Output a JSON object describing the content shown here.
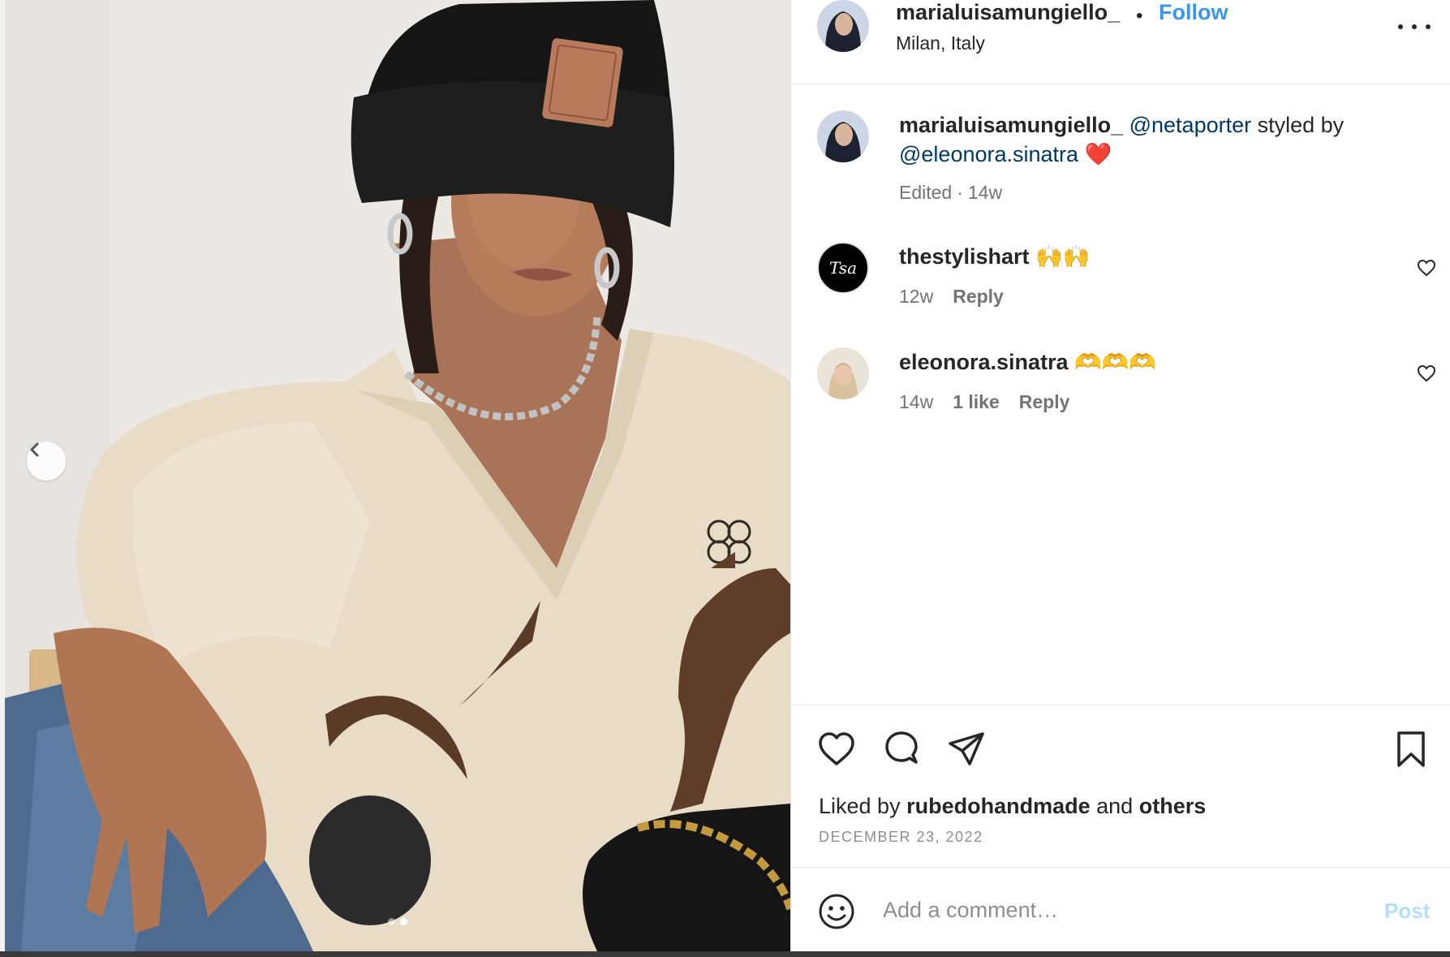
{
  "post": {
    "username": "marialuisamungiello_",
    "separator": "•",
    "follow_label": "Follow",
    "location": "Milan, Italy",
    "more_icon": "more-horizontal-icon"
  },
  "caption": {
    "username": "marialuisamungiello_",
    "mention1": "@netaporter",
    "text_mid": "styled by",
    "mention2": "@eleonora.sinatra",
    "emoji": "❤️",
    "edited": "Edited",
    "dot": "·",
    "time": "14w"
  },
  "comments": [
    {
      "username": "thestylishart",
      "text": "🙌🙌",
      "time": "12w",
      "likes": "",
      "reply_label": "Reply",
      "avatar_text": "Tsa"
    },
    {
      "username": "eleonora.sinatra",
      "text": "🫶🫶🫶",
      "time": "14w",
      "likes": "1 like",
      "reply_label": "Reply"
    }
  ],
  "actions": {
    "liked_prefix": "Liked by",
    "liked_user": "rubedohandmade",
    "liked_and": "and",
    "liked_others": "others",
    "date": "DECEMBER 23, 2022"
  },
  "composer": {
    "placeholder": "Add a comment…",
    "post_label": "Post"
  },
  "carousel": {
    "count": 2,
    "active_index": 1
  },
  "colors": {
    "link_blue": "#3897f0",
    "mention_blue": "#00376b",
    "post_disabled": "#b2dffc",
    "meta_gray": "#737373"
  }
}
